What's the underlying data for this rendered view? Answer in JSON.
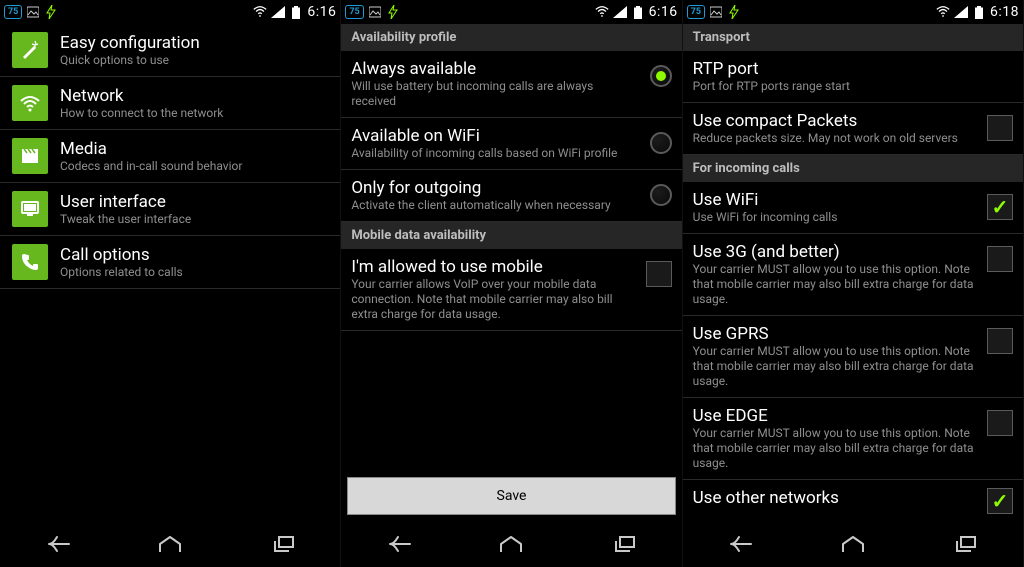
{
  "statusbar": {
    "badge": "75",
    "time1": "6:16",
    "time2": "6:16",
    "time3": "6:18"
  },
  "screen1": {
    "items": [
      {
        "title": "Easy configuration",
        "sub": "Quick options to use",
        "icon": "wand"
      },
      {
        "title": "Network",
        "sub": "How to connect to the network",
        "icon": "wifi"
      },
      {
        "title": "Media",
        "sub": "Codecs and in-call sound behavior",
        "icon": "clapper"
      },
      {
        "title": "User interface",
        "sub": "Tweak the user interface",
        "icon": "screen"
      },
      {
        "title": "Call options",
        "sub": "Options related to calls",
        "icon": "phone"
      }
    ]
  },
  "screen2": {
    "header1": "Availability profile",
    "radios": [
      {
        "title": "Always available",
        "sub": "Will use battery but incoming calls are always received",
        "checked": true
      },
      {
        "title": "Available on WiFi",
        "sub": "Availability of incoming calls based on WiFi profile",
        "checked": false
      },
      {
        "title": "Only for outgoing",
        "sub": "Activate the client automatically when necessary",
        "checked": false
      }
    ],
    "header2": "Mobile data availability",
    "mobile": {
      "title": "I'm allowed to use mobile",
      "sub": "Your carrier allows VoIP over your mobile data connection. Note that mobile carrier may also bill extra charge for data usage.",
      "checked": false
    },
    "save": "Save"
  },
  "screen3": {
    "header1": "Transport",
    "rtp": {
      "title": "RTP port",
      "sub": "Port for RTP ports range start"
    },
    "compact": {
      "title": "Use compact Packets",
      "sub": "Reduce packets size. May not work on old servers",
      "checked": false
    },
    "header2": "For incoming calls",
    "items": [
      {
        "title": "Use WiFi",
        "sub": "Use WiFi for incoming calls",
        "checked": true
      },
      {
        "title": "Use 3G (and better)",
        "sub": "Your carrier MUST allow you to use this option. Note that mobile carrier may also bill extra charge for data usage.",
        "checked": false
      },
      {
        "title": "Use GPRS",
        "sub": "Your carrier MUST allow you to use this option. Note that mobile carrier may also bill extra charge for data usage.",
        "checked": false
      },
      {
        "title": "Use EDGE",
        "sub": "Your carrier MUST allow you to use this option. Note that mobile carrier may also bill extra charge for data usage.",
        "checked": false
      }
    ],
    "other": {
      "title": "Use other networks"
    }
  }
}
